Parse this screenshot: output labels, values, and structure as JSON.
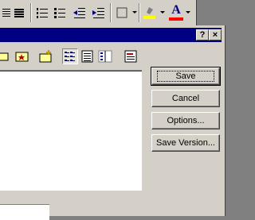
{
  "app_toolbar": {
    "font_color_letter": "A",
    "font_color_accent": "#ff0000",
    "highlight_accent": "#ffff00"
  },
  "dialog": {
    "help_label": "?",
    "close_label": "×",
    "buttons": {
      "save": "Save",
      "cancel": "Cancel",
      "options": "Options...",
      "save_version": "Save Version..."
    },
    "toolbar_icons": [
      "folder-icon",
      "favorites-folder-icon",
      "new-folder-icon",
      "list-view-icon",
      "details-view-icon",
      "properties-view-icon",
      "preview-icon"
    ]
  }
}
